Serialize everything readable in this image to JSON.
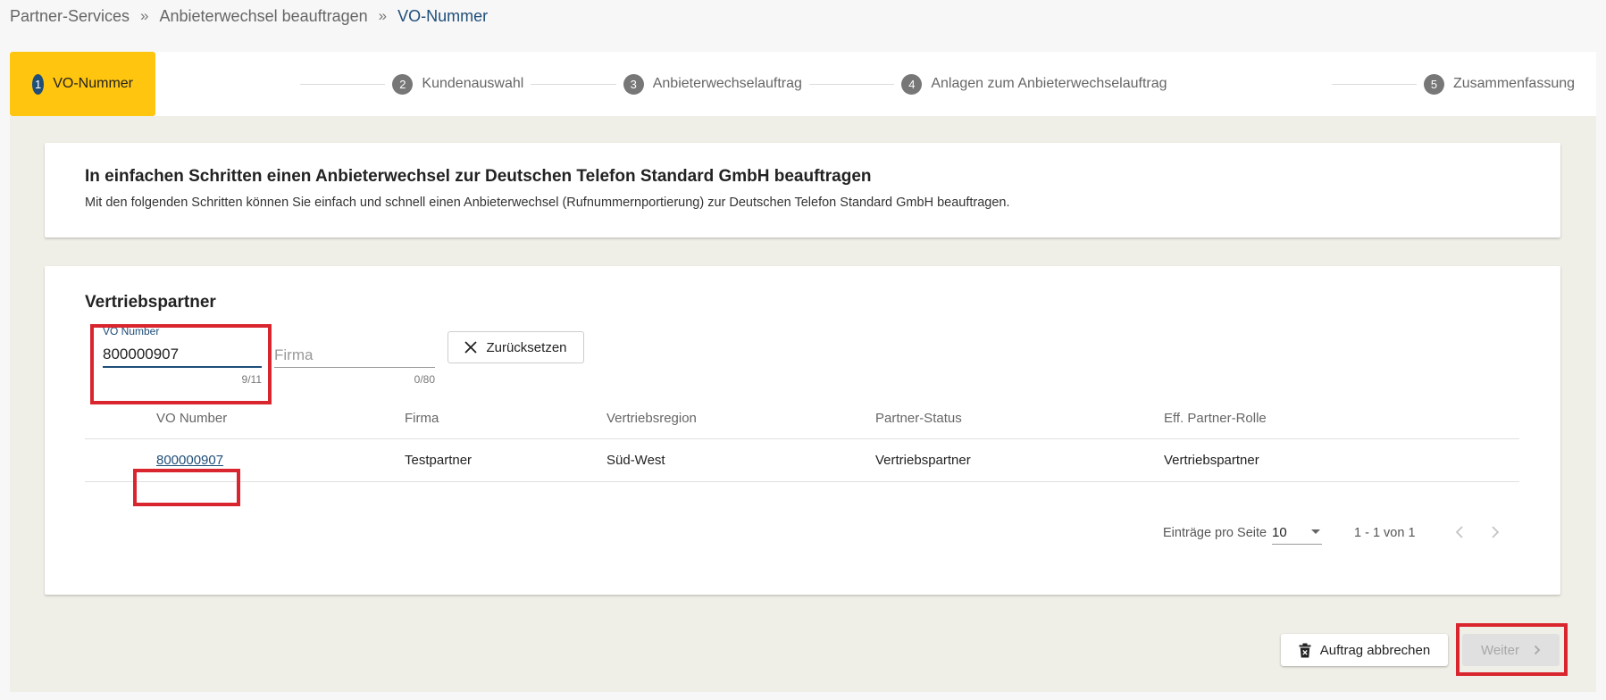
{
  "breadcrumb": {
    "items": [
      "Partner-Services",
      "Anbieterwechsel beauftragen",
      "VO-Nummer"
    ],
    "separator": "»"
  },
  "stepper": {
    "steps": [
      {
        "num": "1",
        "label": "VO-Nummer",
        "active": true
      },
      {
        "num": "2",
        "label": "Kundenauswahl",
        "active": false
      },
      {
        "num": "3",
        "label": "Anbieterwechselauftrag",
        "active": false
      },
      {
        "num": "4",
        "label": "Anlagen zum Anbieterwechselauftrag",
        "active": false
      },
      {
        "num": "5",
        "label": "Zusammenfassung",
        "active": false
      }
    ]
  },
  "intro": {
    "title": "In einfachen Schritten einen Anbieterwechsel zur Deutschen Telefon Standard GmbH beauftragen",
    "text": "Mit den folgenden Schritten können Sie einfach und schnell einen Anbieterwechsel (Rufnummernportierung) zur Deutschen Telefon Standard GmbH beauftragen."
  },
  "partner": {
    "title": "Vertriebspartner",
    "vo_field": {
      "label": "VO Number",
      "value": "800000907",
      "counter": "9/11"
    },
    "firma_field": {
      "placeholder": "Firma",
      "value": "",
      "counter": "0/80"
    },
    "reset_label": "Zurücksetzen",
    "table": {
      "headers": [
        "VO Number",
        "Firma",
        "Vertriebsregion",
        "Partner-Status",
        "Eff. Partner-Rolle"
      ],
      "rows": [
        [
          "800000907",
          "Testpartner",
          "Süd-West",
          "Vertriebspartner",
          "Vertriebspartner"
        ]
      ]
    },
    "paginator": {
      "label": "Einträge pro Seite",
      "page_size": "10",
      "range": "1 - 1 von 1"
    }
  },
  "actions": {
    "cancel_label": "Auftrag abbrechen",
    "next_label": "Weiter"
  },
  "colors": {
    "accent_yellow": "#ffc50f",
    "brand_blue": "#1f4e79",
    "highlight_red": "#d9262e",
    "content_bg": "#f0efe7"
  },
  "icons": {
    "reset": "close-icon",
    "cancel": "trash-icon",
    "next": "chevron-right-icon",
    "prev_page": "chevron-left-icon",
    "next_page": "chevron-right-icon"
  }
}
